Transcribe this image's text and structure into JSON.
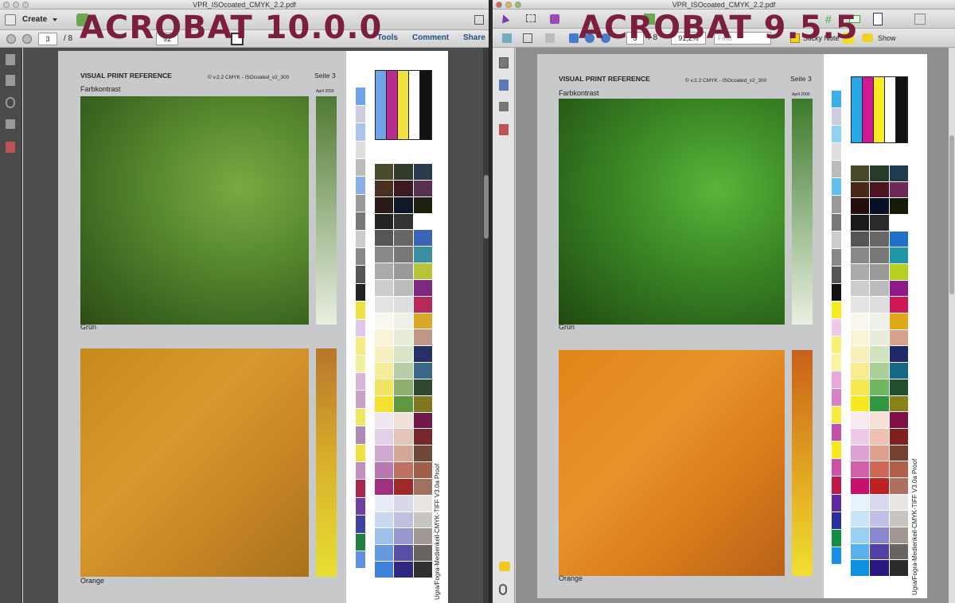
{
  "left": {
    "filename": "VPR_ISOcoated_CMYK_2.2.pdf",
    "overlay": "ACROBAT 10.0.0",
    "toolbar": {
      "create_label": "Create",
      "page_current": "3",
      "page_total": "/ 8",
      "zoom": "92",
      "tools": "Tools",
      "comment": "Comment",
      "share": "Share"
    }
  },
  "right": {
    "filename": "VPR_ISOcoated_CMYK_2.2.pdf",
    "overlay": "ACROBAT 9.5.5",
    "toolbar": {
      "page_current": "3",
      "page_total": "/ 8",
      "zoom": "91,2%",
      "find_placeholder": "Find",
      "sticky_note": "Sticky Note",
      "show": "Show"
    }
  },
  "document": {
    "title": "VISUAL PRINT REFERENCE",
    "version": "© v.2.2 CMYK - ISOcoated_v2_300",
    "page": "Seite 3",
    "date": "April 2009",
    "section1": "Farbkontrast",
    "label_green": "Grün",
    "label_orange": "Orange",
    "wedge": "Ugra/Fogra-Medienkeil-CMYK-TIFF V3.0a Proof"
  },
  "colors": {
    "overlay": "#7a1f3d",
    "link": "#1e4d87"
  }
}
